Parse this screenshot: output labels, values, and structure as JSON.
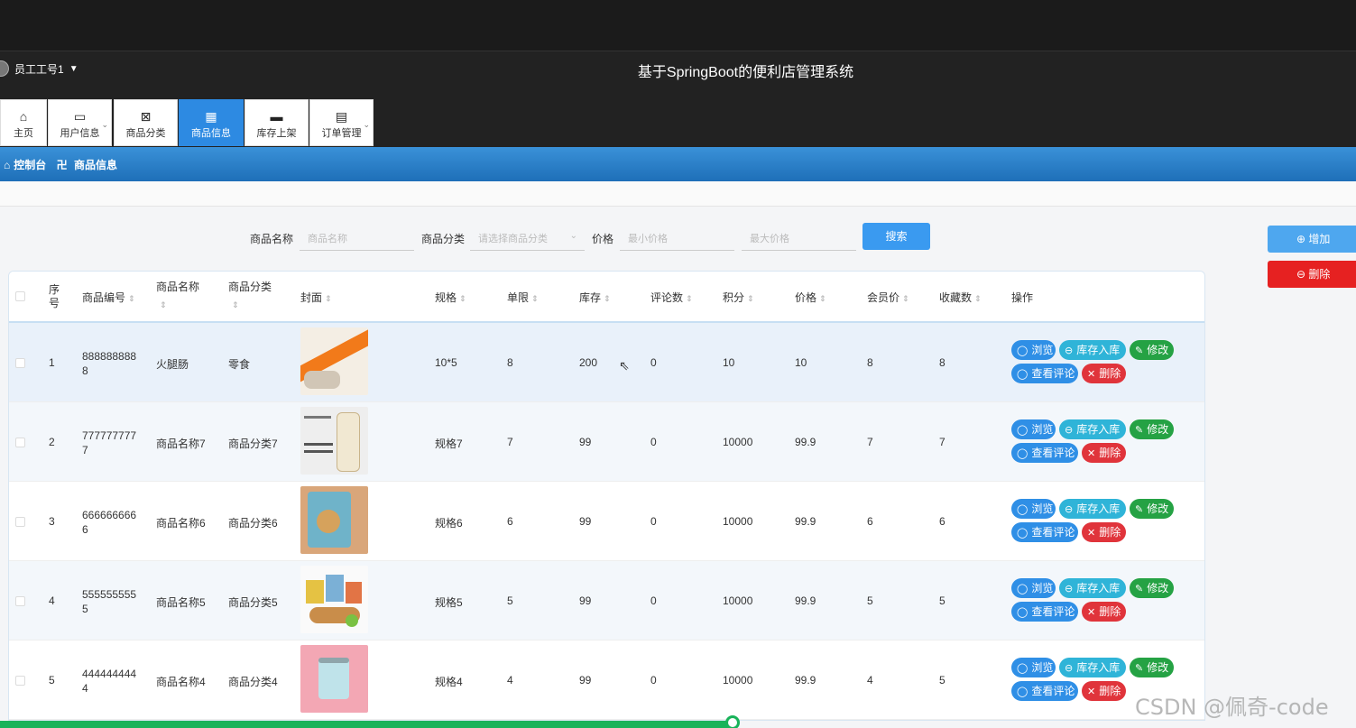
{
  "header": {
    "user_name": "员工工号1",
    "user_caret": "▼",
    "system_title": "基于SpringBoot的便利店管理系统"
  },
  "nav": [
    {
      "label": "主页",
      "icon": "home-icon",
      "glyph": "⌂"
    },
    {
      "label": "用户信息",
      "icon": "card-icon",
      "glyph": "▭",
      "dropdown": "⌄"
    },
    {
      "label": "商品分类",
      "icon": "box-icon",
      "glyph": "⊠"
    },
    {
      "label": "商品信息",
      "icon": "grid-icon",
      "glyph": "▦",
      "active": true
    },
    {
      "label": "库存上架",
      "icon": "briefcase-icon",
      "glyph": "▬"
    },
    {
      "label": "订单管理",
      "icon": "clipboard-icon",
      "glyph": "▤",
      "dropdown": "⌄"
    }
  ],
  "breadcrumb": {
    "home_icon": "⌂",
    "home": "控制台",
    "separator": "卍",
    "current": "商品信息"
  },
  "search": {
    "name_label": "商品名称",
    "name_placeholder": "商品名称",
    "category_label": "商品分类",
    "category_placeholder": "请选择商品分类",
    "category_chevron": "⌄",
    "price_label": "价格",
    "min_price_placeholder": "最小价格",
    "max_price_placeholder": "最大价格",
    "search_button": "搜索"
  },
  "actions": {
    "add": "增加",
    "add_icon": "⊕",
    "delete": "删除",
    "delete_icon": "⊖"
  },
  "table": {
    "headers": {
      "index": "序号",
      "code": "商品编号",
      "name": "商品名称",
      "category": "商品分类",
      "cover": "封面",
      "spec": "规格",
      "limit": "单限",
      "stock": "库存",
      "reviews": "评论数",
      "points": "积分",
      "price": "价格",
      "member_price": "会员价",
      "favorites": "收藏数",
      "ops": "操作"
    },
    "sort_glyph": "⇕",
    "op_labels": {
      "view": "浏览",
      "stock_in": "库存入库",
      "edit": "修改",
      "reviews": "查看评论",
      "delete": "删除"
    },
    "op_glyphs": {
      "view": "◯",
      "stock_in": "⊖",
      "edit": "✎",
      "reviews": "◯",
      "delete": "✕"
    },
    "rows": [
      {
        "index": "1",
        "code_a": "888888888",
        "code_b": "8",
        "name": "火腿肠",
        "category": "零食",
        "spec": "10*5",
        "limit": "8",
        "stock": "200",
        "reviews": "0",
        "points": "10",
        "price": "10",
        "member_price": "8",
        "favorites": "8",
        "cover": "orange-sausage"
      },
      {
        "index": "2",
        "code_a": "777777777",
        "code_b": "7",
        "name": "商品名称7",
        "category": "商品分类7",
        "spec": "规格7",
        "limit": "7",
        "stock": "99",
        "reviews": "0",
        "points": "10000",
        "price": "99.9",
        "member_price": "7",
        "favorites": "7",
        "cover": "drink-bottle"
      },
      {
        "index": "3",
        "code_a": "666666666",
        "code_b": "6",
        "name": "商品名称6",
        "category": "商品分类6",
        "spec": "规格6",
        "limit": "6",
        "stock": "99",
        "reviews": "0",
        "points": "10000",
        "price": "99.9",
        "member_price": "6",
        "favorites": "6",
        "cover": "cookie-bag"
      },
      {
        "index": "4",
        "code_a": "555555555",
        "code_b": "5",
        "name": "商品名称5",
        "category": "商品分类5",
        "spec": "规格5",
        "limit": "5",
        "stock": "99",
        "reviews": "0",
        "points": "10000",
        "price": "99.9",
        "member_price": "5",
        "favorites": "5",
        "cover": "snack-assortment"
      },
      {
        "index": "5",
        "code_a": "444444444",
        "code_b": "4",
        "name": "商品名称4",
        "category": "商品分类4",
        "spec": "规格4",
        "limit": "4",
        "stock": "99",
        "reviews": "0",
        "points": "10000",
        "price": "99.9",
        "member_price": "4",
        "favorites": "5",
        "cover": "pink-can"
      }
    ]
  },
  "watermark": "CSDN @佩奇-code",
  "colors": {
    "accent": "#2d8ae2",
    "danger": "#e62121",
    "success": "#25a244",
    "progress": "#19b35a"
  }
}
